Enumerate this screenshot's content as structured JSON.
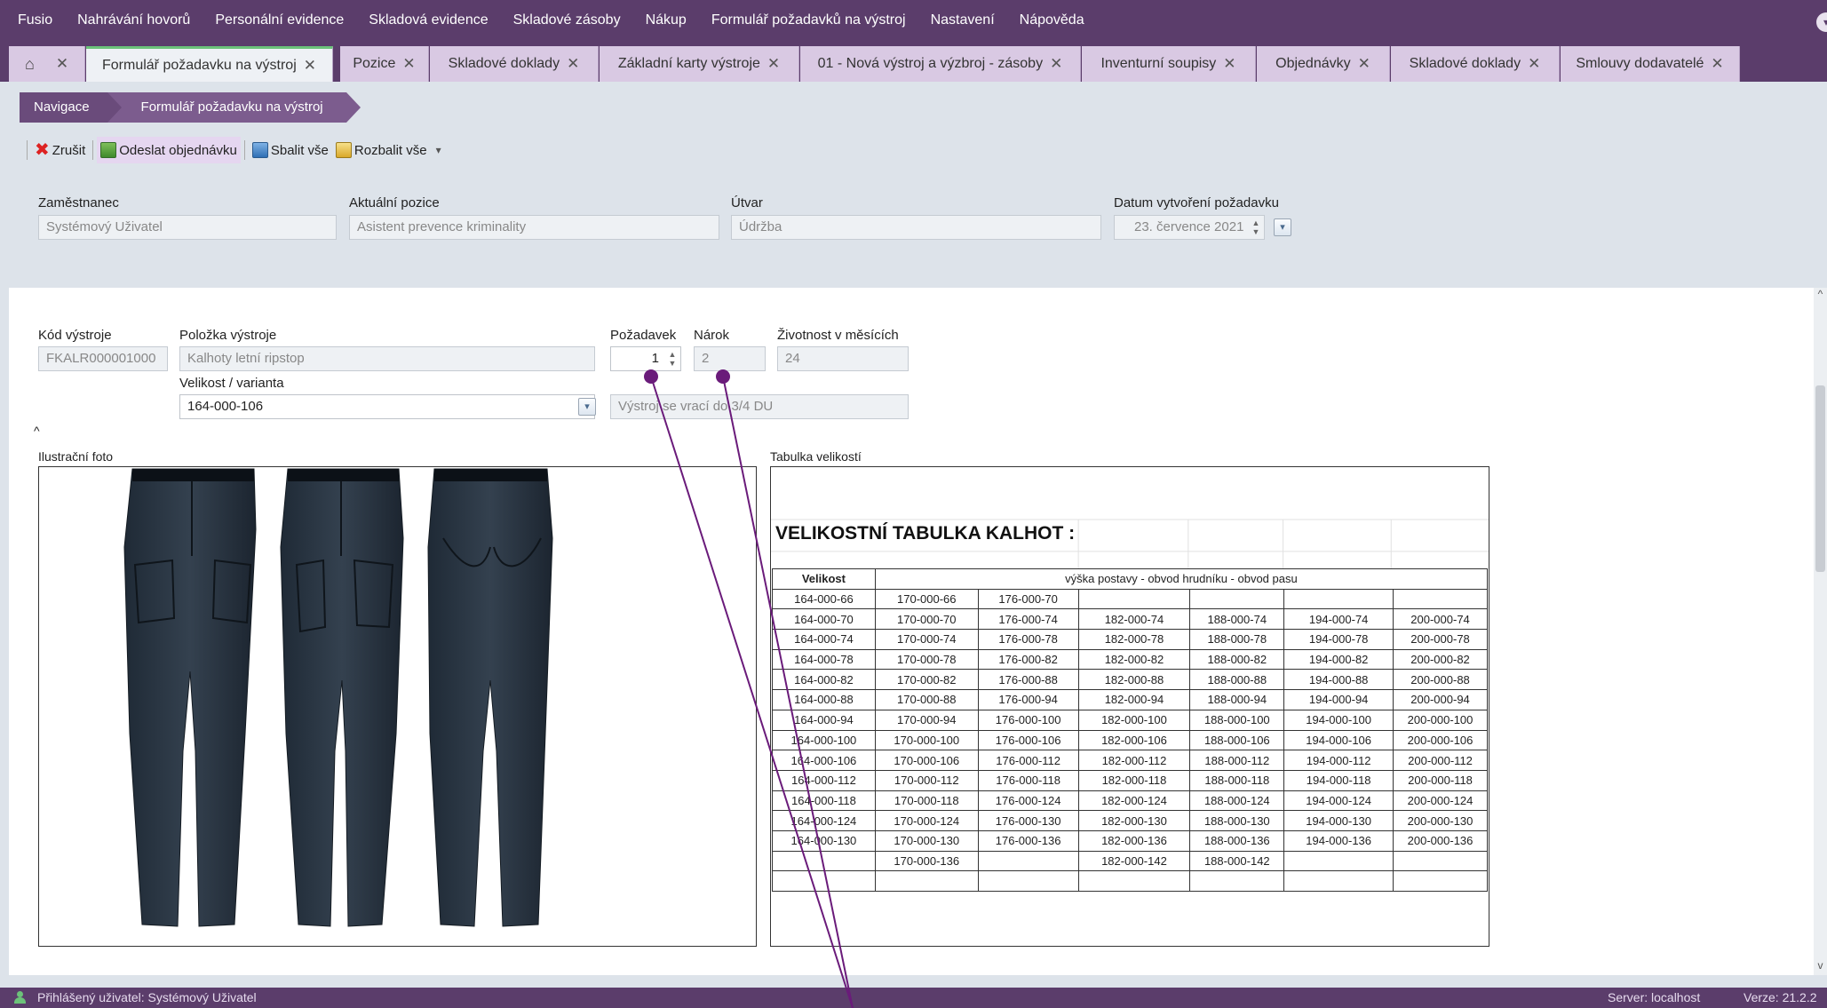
{
  "menu": [
    "Fusio",
    "Nahrávání hovorů",
    "Personální evidence",
    "Skladová evidence",
    "Skladové zásoby",
    "Nákup",
    "Formulář požadavků na výstroj",
    "Nastavení",
    "Nápověda"
  ],
  "tabs": [
    {
      "label": "Formulář požadavku na výstroj"
    },
    {
      "label": "Pozice"
    },
    {
      "label": "Skladové doklady"
    },
    {
      "label": "Základní karty výstroje"
    },
    {
      "label": "01 - Nová výstroj a výzbroj - zásoby"
    },
    {
      "label": "Inventurní soupisy"
    },
    {
      "label": "Objednávky"
    },
    {
      "label": "Skladové doklady"
    },
    {
      "label": "Smlouvy dodavatelé"
    }
  ],
  "tab_close": "✕",
  "breadcrumb": {
    "root": "Navigace",
    "current": "Formulář požadavku na výstroj"
  },
  "toolbar": {
    "cancel": "Zrušit",
    "send_order": "Odeslat objednávku",
    "collapse_all": "Sbalit vše",
    "expand_all": "Rozbalit vše"
  },
  "header": {
    "employee_label": "Zaměstnanec",
    "employee": "Systémový Uživatel",
    "position_label": "Aktuální pozice",
    "position": "Asistent prevence kriminality",
    "unit_label": "Útvar",
    "unit": "Údržba",
    "date_label": "Datum vytvoření požadavku",
    "date": "23. července 2021"
  },
  "item": {
    "code_label": "Kód výstroje",
    "code": "FKALR000001000",
    "name_label": "Položka výstroje",
    "name": "Kalhoty letní ripstop",
    "request_label": "Požadavek",
    "request": "1",
    "entitlement_label": "Nárok",
    "entitlement": "2",
    "lifetime_label": "Životnost v měsících",
    "lifetime": "24",
    "variant_label": "Velikost / varianta",
    "variant": "164-000-106",
    "return_note": "Výstroj se vrací do 3/4 DU"
  },
  "photo_label": "Ilustrační foto",
  "size_table_label": "Tabulka velikostí",
  "size_table": {
    "title": "VELIKOSTNÍ TABULKA KALHOT :",
    "col1": "Velikost",
    "caption": "výška postavy - obvod hrudníku - obvod pasu",
    "rows": [
      [
        "164-000-66",
        "170-000-66",
        "176-000-70",
        "",
        "",
        "",
        ""
      ],
      [
        "164-000-70",
        "170-000-70",
        "176-000-74",
        "182-000-74",
        "188-000-74",
        "194-000-74",
        "200-000-74"
      ],
      [
        "164-000-74",
        "170-000-74",
        "176-000-78",
        "182-000-78",
        "188-000-78",
        "194-000-78",
        "200-000-78"
      ],
      [
        "164-000-78",
        "170-000-78",
        "176-000-82",
        "182-000-82",
        "188-000-82",
        "194-000-82",
        "200-000-82"
      ],
      [
        "164-000-82",
        "170-000-82",
        "176-000-88",
        "182-000-88",
        "188-000-88",
        "194-000-88",
        "200-000-88"
      ],
      [
        "164-000-88",
        "170-000-88",
        "176-000-94",
        "182-000-94",
        "188-000-94",
        "194-000-94",
        "200-000-94"
      ],
      [
        "164-000-94",
        "170-000-94",
        "176-000-100",
        "182-000-100",
        "188-000-100",
        "194-000-100",
        "200-000-100"
      ],
      [
        "164-000-100",
        "170-000-100",
        "176-000-106",
        "182-000-106",
        "188-000-106",
        "194-000-106",
        "200-000-106"
      ],
      [
        "164-000-106",
        "170-000-106",
        "176-000-112",
        "182-000-112",
        "188-000-112",
        "194-000-112",
        "200-000-112"
      ],
      [
        "164-000-112",
        "170-000-112",
        "176-000-118",
        "182-000-118",
        "188-000-118",
        "194-000-118",
        "200-000-118"
      ],
      [
        "164-000-118",
        "170-000-118",
        "176-000-124",
        "182-000-124",
        "188-000-124",
        "194-000-124",
        "200-000-124"
      ],
      [
        "164-000-124",
        "170-000-124",
        "176-000-130",
        "182-000-130",
        "188-000-130",
        "194-000-130",
        "200-000-130"
      ],
      [
        "164-000-130",
        "170-000-130",
        "176-000-136",
        "182-000-136",
        "188-000-136",
        "194-000-136",
        "200-000-136"
      ],
      [
        "",
        "170-000-136",
        "",
        "182-000-142",
        "188-000-142",
        "",
        ""
      ],
      [
        "",
        "",
        "",
        "",
        "",
        "",
        ""
      ]
    ]
  },
  "status": {
    "user": "Přihlášený uživatel: Systémový Uživatel",
    "server": "Server: localhost",
    "version": "Verze: 21.2.2"
  },
  "colors": {
    "brand": "#5b3d6b",
    "tab": "#d9c9e3",
    "active_tab_accent": "#6cc27a",
    "annotation": "#6a1b7a"
  }
}
